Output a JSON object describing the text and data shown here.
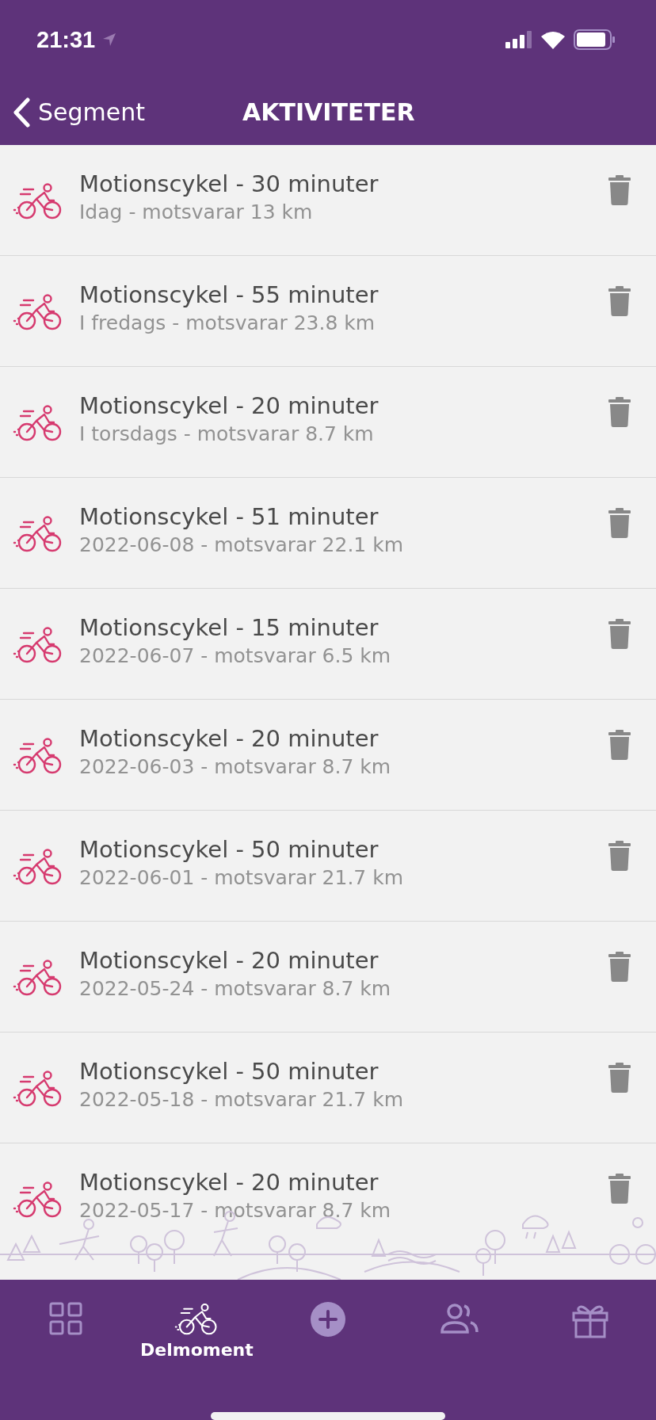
{
  "status_bar": {
    "time": "21:31"
  },
  "nav": {
    "back_label": "Segment",
    "title": "AKTIVITETER"
  },
  "activities": [
    {
      "title": "Motionscykel - 30 minuter",
      "subtitle": "Idag - motsvarar 13 km"
    },
    {
      "title": "Motionscykel - 55 minuter",
      "subtitle": "I fredags - motsvarar 23.8 km"
    },
    {
      "title": "Motionscykel - 20 minuter",
      "subtitle": "I torsdags - motsvarar 8.7 km"
    },
    {
      "title": "Motionscykel - 51 minuter",
      "subtitle": "2022-06-08 - motsvarar 22.1 km"
    },
    {
      "title": "Motionscykel - 15 minuter",
      "subtitle": "2022-06-07 - motsvarar 6.5 km"
    },
    {
      "title": "Motionscykel - 20 minuter",
      "subtitle": "2022-06-03 - motsvarar 8.7 km"
    },
    {
      "title": "Motionscykel - 50 minuter",
      "subtitle": "2022-06-01 - motsvarar 21.7 km"
    },
    {
      "title": "Motionscykel - 20 minuter",
      "subtitle": "2022-05-24 - motsvarar 8.7 km"
    },
    {
      "title": "Motionscykel - 50 minuter",
      "subtitle": "2022-05-18 - motsvarar 21.7 km"
    },
    {
      "title": "Motionscykel - 20 minuter",
      "subtitle": "2022-05-17 - motsvarar 8.7 km"
    }
  ],
  "tabs": [
    {
      "kind": "grid",
      "selected": false
    },
    {
      "kind": "bike",
      "label": "Delmoment",
      "selected": true
    },
    {
      "kind": "add",
      "selected": false
    },
    {
      "kind": "people",
      "selected": false
    },
    {
      "kind": "gift",
      "selected": false
    }
  ]
}
